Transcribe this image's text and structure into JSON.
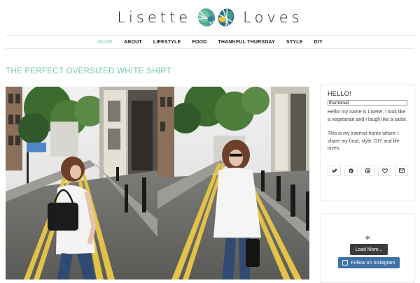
{
  "header": {
    "logo_left": "Lisette",
    "logo_right": "Loves"
  },
  "nav": {
    "items": [
      {
        "label": "HOME",
        "active": true
      },
      {
        "label": "ABOUT"
      },
      {
        "label": "LIFESTYLE"
      },
      {
        "label": "FOOD"
      },
      {
        "label": "THANKFUL THURSDAY"
      },
      {
        "label": "STYLE"
      },
      {
        "label": "DIY"
      }
    ]
  },
  "post": {
    "title": "THE PERFECT OVERSIZED WHITE SHIRT"
  },
  "sidebar": {
    "about": {
      "heading": "HELLO!",
      "thumbnail_alt": "thumbnail",
      "bio_1": "Hello! my name is Lisette, I look like a vegetarian and I laugh like a sailor.",
      "bio_2": "This is my internet home where I share my food, style, DIY and life loves."
    },
    "social_icons": [
      "twitter-icon",
      "pinterest-icon",
      "instagram-icon",
      "heart-icon",
      "mail-icon"
    ],
    "instagram": {
      "load_more": "Load More...",
      "follow": "Follow on Instagram"
    }
  },
  "colors": {
    "accent": "#78c7b6",
    "follow_button": "#3f72a5",
    "load_more_button": "#3c3c3c"
  }
}
